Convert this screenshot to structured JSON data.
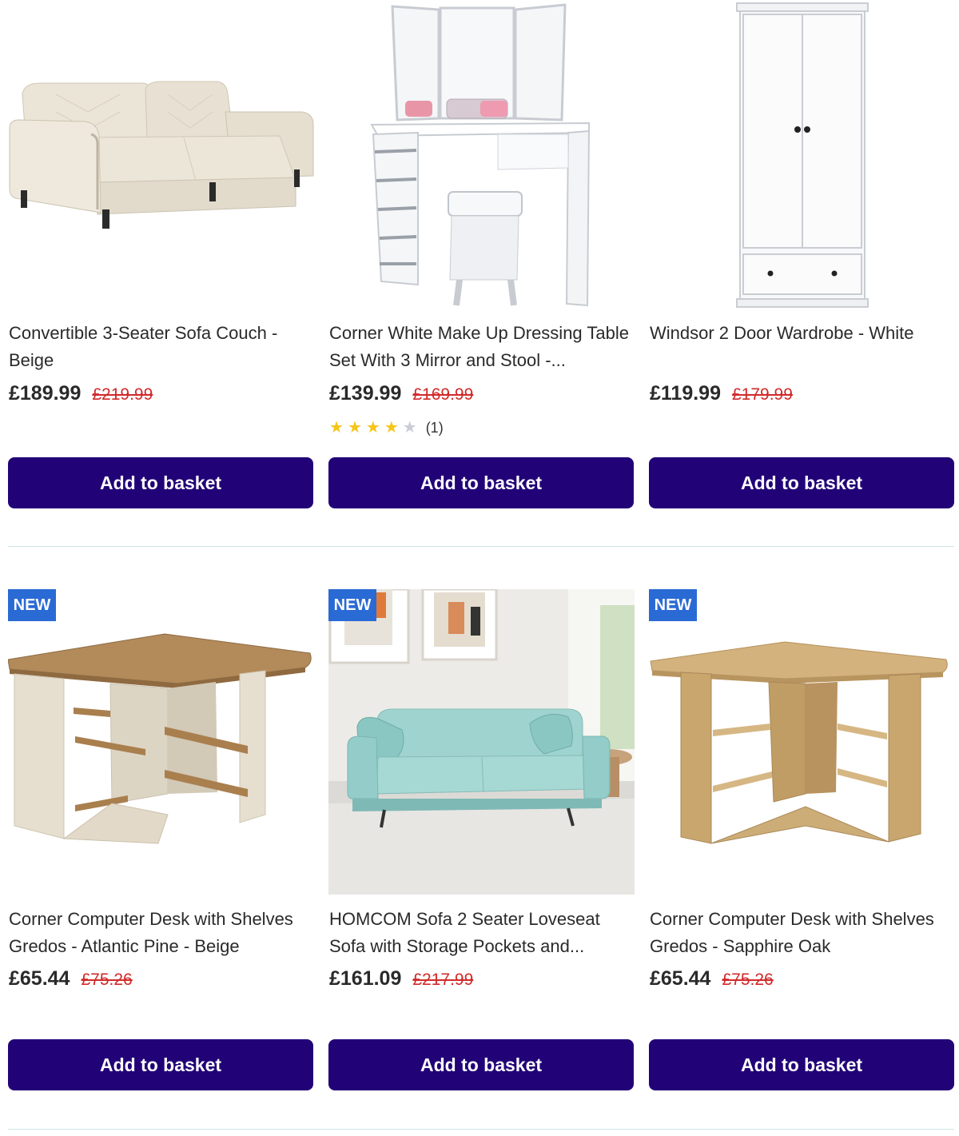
{
  "products": [
    {
      "title": "Convertible 3-Seater Sofa Couch - Beige",
      "price": "£189.99",
      "was_price": "£219.99",
      "button": "Add to basket",
      "image": "beige-sofa-bed"
    },
    {
      "title": "Corner White Make Up Dressing Table Set With 3 Mirror and Stool -...",
      "price": "£139.99",
      "was_price": "£169.99",
      "rating": {
        "value": 4,
        "max": 5,
        "count_label": "(1)"
      },
      "button": "Add to basket",
      "image": "white-corner-dressing-table"
    },
    {
      "title": "Windsor 2 Door Wardrobe - White",
      "price": "£119.99",
      "was_price": "£179.99",
      "button": "Add to basket",
      "image": "white-wardrobe"
    },
    {
      "badge": "NEW",
      "title": "Corner Computer Desk with Shelves Gredos - Atlantic Pine - Beige",
      "price": "£65.44",
      "was_price": "£75.26",
      "button": "Add to basket",
      "image": "corner-desk-pine-beige"
    },
    {
      "badge": "NEW",
      "title": "HOMCOM Sofa 2 Seater Loveseat Sofa with Storage Pockets and...",
      "price": "£161.09",
      "was_price": "£217.99",
      "button": "Add to basket",
      "image": "mint-loveseat-sofa-room"
    },
    {
      "badge": "NEW",
      "title": "Corner Computer Desk with Shelves Gredos - Sapphire Oak",
      "price": "£65.44",
      "was_price": "£75.26",
      "button": "Add to basket",
      "image": "corner-desk-sapphire-oak"
    }
  ],
  "colors": {
    "button_bg": "#220377",
    "badge_bg": "#2a6ad4",
    "was_price": "#d22a2a",
    "star_on": "#f5c518",
    "star_off": "#c9ccd6"
  }
}
